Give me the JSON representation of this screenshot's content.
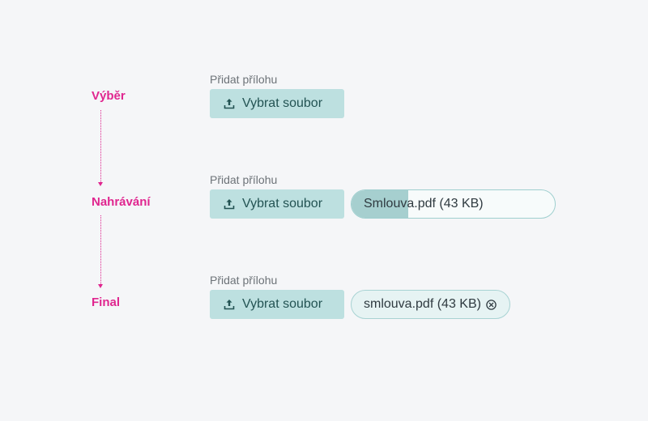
{
  "stages": [
    {
      "label": "Výběr"
    },
    {
      "label": "Nahrávání"
    },
    {
      "label": "Final"
    }
  ],
  "rows": [
    {
      "field_label": "Přidat přílohu",
      "button_label": "Vybrat soubor",
      "button_icon": "upload-icon"
    },
    {
      "field_label": "Přidat přílohu",
      "button_label": "Vybrat soubor",
      "button_icon": "upload-icon",
      "file_text": "Smlouva.pdf (43 KB)",
      "upload_progress": 0.28
    },
    {
      "field_label": "Přidat přílohu",
      "button_label": "Vybrat soubor",
      "button_icon": "upload-icon",
      "file_text": "smlouva.pdf (43 KB)",
      "remove_icon": "close-circle-icon"
    }
  ],
  "colors": {
    "stage_accent": "#e0268f",
    "button_bg": "#bde0e0",
    "button_text": "#235353",
    "progress_fill": "#a6cfcf"
  }
}
